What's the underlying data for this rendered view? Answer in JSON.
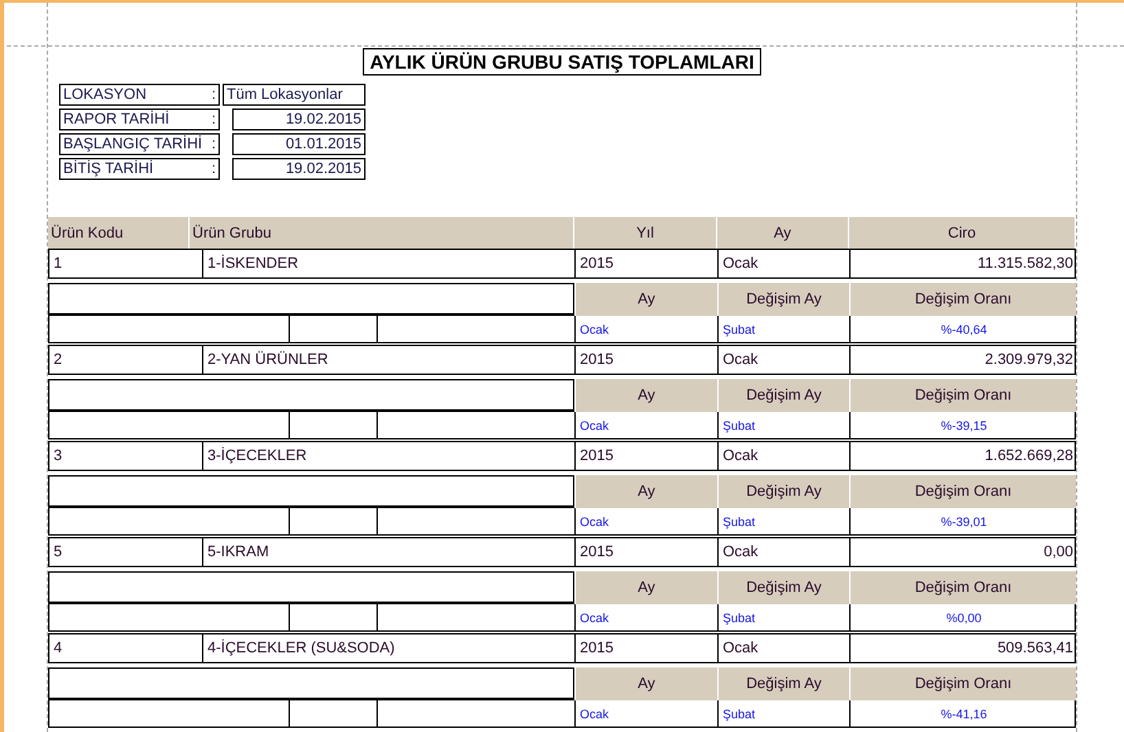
{
  "title": "AYLIK ÜRÜN GRUBU SATIŞ TOPLAMLARI",
  "info": [
    {
      "label": "LOKASYON",
      "sep": ":",
      "value": "Tüm Lokasyonlar",
      "kind": "wide"
    },
    {
      "label": "RAPOR TARİHİ",
      "sep": ":",
      "value": "19.02.2015",
      "kind": "date"
    },
    {
      "label": "BAŞLANGIÇ TARİHİ",
      "sep": ":",
      "value": "01.01.2015",
      "kind": "date"
    },
    {
      "label": "BİTİŞ TARİHİ",
      "sep": ":",
      "value": "19.02.2015",
      "kind": "date"
    }
  ],
  "columns": [
    "Ürün Kodu",
    "Ürün Grubu",
    "Yıl",
    "Ay",
    "Ciro"
  ],
  "groups": [
    {
      "code": "1",
      "name": "1-İSKENDER",
      "year": "2015",
      "month": "Ocak",
      "revenue": "11.315.582,30",
      "sub_columns": [
        "Ay",
        "Değişim Ay",
        "Değişim Oranı"
      ],
      "detail": {
        "month": "Ocak",
        "change_month": "Şubat",
        "change_rate": "%-40,64"
      }
    },
    {
      "code": "2",
      "name": "2-YAN ÜRÜNLER",
      "year": "2015",
      "month": "Ocak",
      "revenue": "2.309.979,32",
      "sub_columns": [
        "Ay",
        "Değişim Ay",
        "Değişim Oranı"
      ],
      "detail": {
        "month": "Ocak",
        "change_month": "Şubat",
        "change_rate": "%-39,15"
      }
    },
    {
      "code": "3",
      "name": "3-İÇECEKLER",
      "year": "2015",
      "month": "Ocak",
      "revenue": "1.652.669,28",
      "sub_columns": [
        "Ay",
        "Değişim Ay",
        "Değişim Oranı"
      ],
      "detail": {
        "month": "Ocak",
        "change_month": "Şubat",
        "change_rate": "%-39,01"
      }
    },
    {
      "code": "5",
      "name": "5-IKRAM",
      "year": "2015",
      "month": "Ocak",
      "revenue": "0,00",
      "sub_columns": [
        "Ay",
        "Değişim Ay",
        "Değişim Oranı"
      ],
      "detail": {
        "month": "Ocak",
        "change_month": "Şubat",
        "change_rate": "%0,00"
      }
    },
    {
      "code": "4",
      "name": "4-İÇECEKLER (SU&SODA)",
      "year": "2015",
      "month": "Ocak",
      "revenue": "509.563,41",
      "sub_columns": [
        "Ay",
        "Değişim Ay",
        "Değişim Oranı"
      ],
      "detail": {
        "month": "Ocak",
        "change_month": "Şubat",
        "change_rate": "%-41,16"
      }
    }
  ]
}
